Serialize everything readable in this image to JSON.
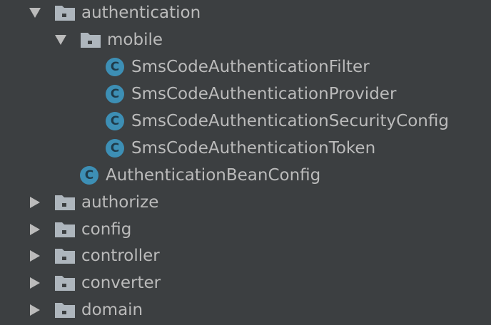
{
  "tree": {
    "items": [
      {
        "label": "authentication",
        "type": "folder",
        "expanded": true,
        "icon": "folder-icon"
      },
      {
        "label": "mobile",
        "type": "folder",
        "expanded": true,
        "icon": "folder-icon"
      },
      {
        "label": "SmsCodeAuthenticationFilter",
        "type": "class",
        "icon": "class-icon",
        "icon_letter": "C"
      },
      {
        "label": "SmsCodeAuthenticationProvider",
        "type": "class",
        "icon": "class-icon",
        "icon_letter": "C"
      },
      {
        "label": "SmsCodeAuthenticationSecurityConfig",
        "type": "class",
        "icon": "class-icon",
        "icon_letter": "C"
      },
      {
        "label": "SmsCodeAuthenticationToken",
        "type": "class",
        "icon": "class-icon",
        "icon_letter": "C"
      },
      {
        "label": "AuthenticationBeanConfig",
        "type": "class",
        "icon": "class-icon",
        "icon_letter": "C"
      },
      {
        "label": "authorize",
        "type": "folder",
        "expanded": false,
        "icon": "folder-icon"
      },
      {
        "label": "config",
        "type": "folder",
        "expanded": false,
        "icon": "folder-icon"
      },
      {
        "label": "controller",
        "type": "folder",
        "expanded": false,
        "icon": "folder-icon"
      },
      {
        "label": "converter",
        "type": "folder",
        "expanded": false,
        "icon": "folder-icon"
      },
      {
        "label": "domain",
        "type": "folder",
        "expanded": false,
        "icon": "folder-icon"
      }
    ]
  },
  "colors": {
    "background": "#3c3f41",
    "text": "#bbbbbb",
    "folder": "#aeb6bd",
    "class_icon": "#3d8fb5"
  }
}
